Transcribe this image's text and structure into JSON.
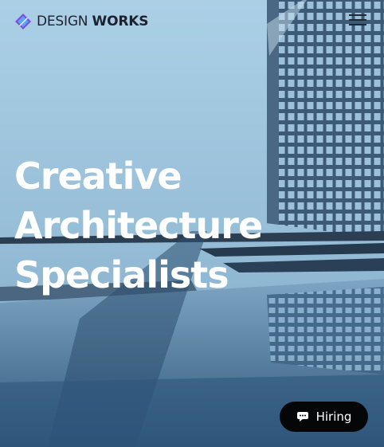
{
  "brand": {
    "name_light": "DESIGN",
    "name_bold": "WORKS",
    "logo_icon": "diamond-pencil-logo-icon",
    "colors": {
      "text": "#1c2230",
      "mark_purple": "#7b4fe0",
      "mark_blue": "#5ea3f3"
    }
  },
  "header": {
    "menu_icon": "hamburger-menu-icon"
  },
  "hero": {
    "headline_lines": [
      "Creative",
      "Architecture",
      "Specialists"
    ],
    "headline_color": "#ffffff"
  },
  "hiring_button": {
    "label": "Hiring",
    "icon": "chat-bubble-icon",
    "background": "#050608"
  }
}
